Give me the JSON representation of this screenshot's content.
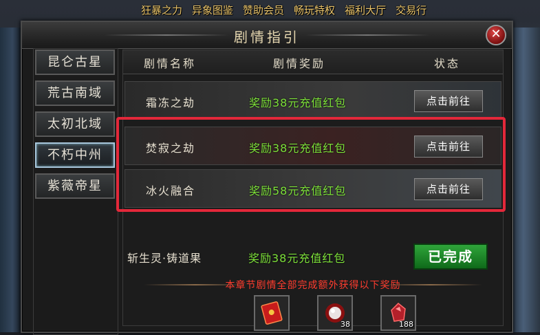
{
  "top_menu": [
    "狂暴之力",
    "异象图鉴",
    "赞助会员",
    "畅玩特权",
    "福利大厅",
    "交易行"
  ],
  "window": {
    "title": "剧情指引",
    "close_glyph": "✕"
  },
  "nav": {
    "items": [
      {
        "label": "昆仑古星"
      },
      {
        "label": "荒古南域"
      },
      {
        "label": "太初北域"
      },
      {
        "label": "不朽中州",
        "active": true
      },
      {
        "label": "紫薇帝星"
      }
    ]
  },
  "table": {
    "headers": {
      "name": "剧情名称",
      "reward": "剧情奖励",
      "status": "状态"
    },
    "rows": [
      {
        "name": "霜冻之劫",
        "reward": "奖励38元充值红包",
        "action": "点击前往"
      },
      {
        "name": "焚寂之劫",
        "reward": "奖励38元充值红包",
        "action": "点击前往"
      },
      {
        "name": "冰火融合",
        "reward": "奖励58元充值红包",
        "action": "点击前往"
      },
      {
        "name": "斩生灵·铸道果",
        "reward": "奖励38元充值红包",
        "status": "已完成"
      }
    ]
  },
  "bonus": {
    "text": "本章节剧情全部完成额外获得以下奖励",
    "items": [
      {
        "icon": "red-envelope-icon",
        "qty": ""
      },
      {
        "icon": "pearl-orb-icon",
        "qty": "38"
      },
      {
        "icon": "red-gem-icon",
        "qty": "188"
      }
    ]
  },
  "colors": {
    "reward_green": "#7ee23a",
    "highlight_red": "#e3283a",
    "done_green": "#2fa53a",
    "bonus_red": "#ff3c2e"
  }
}
